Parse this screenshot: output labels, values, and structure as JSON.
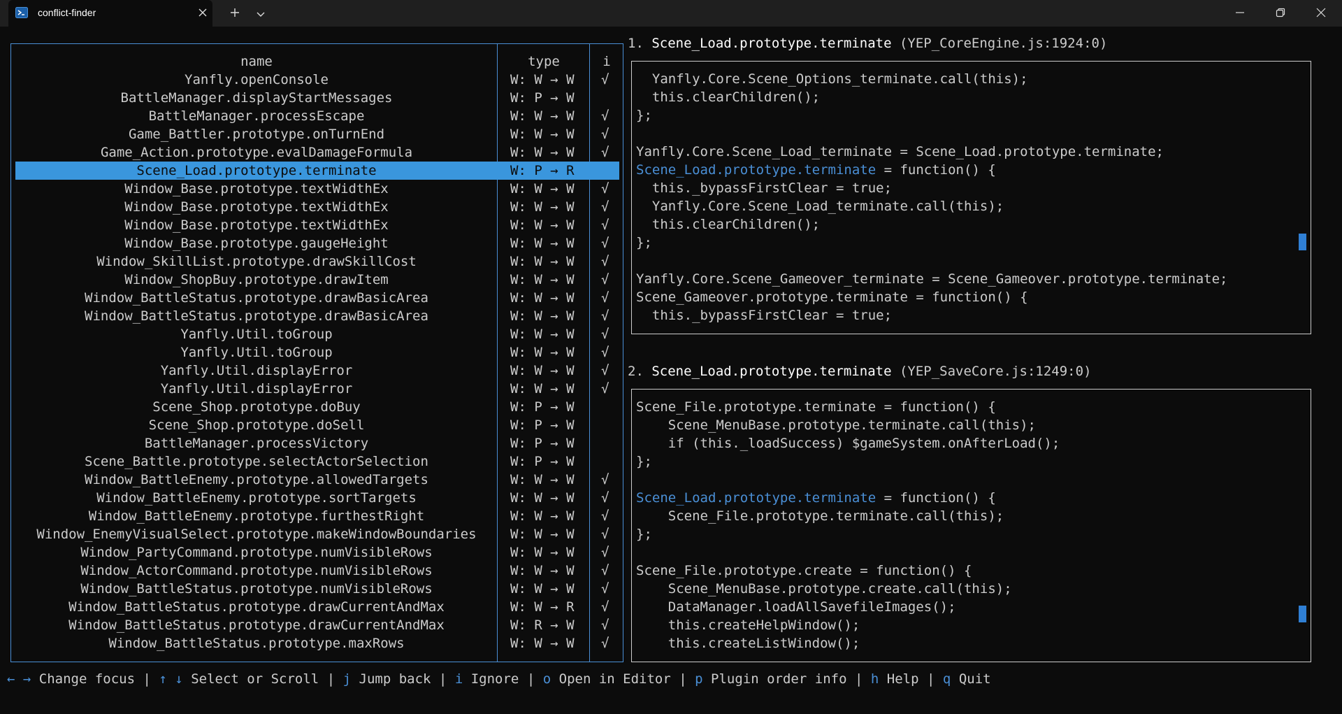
{
  "window": {
    "tab_title": "conflict-finder",
    "new_tab_icon": "plus-icon",
    "dropdown_icon": "chevron-down-icon"
  },
  "table": {
    "headers": {
      "name": "name",
      "type": "type",
      "ignore": "i"
    },
    "selected_index": 5,
    "rows": [
      {
        "name": "Yanfly.openConsole",
        "type": "W: W → W",
        "ignored": "√"
      },
      {
        "name": "BattleManager.displayStartMessages",
        "type": "W: P → W",
        "ignored": ""
      },
      {
        "name": "BattleManager.processEscape",
        "type": "W: W → W",
        "ignored": "√"
      },
      {
        "name": "Game_Battler.prototype.onTurnEnd",
        "type": "W: W → W",
        "ignored": "√"
      },
      {
        "name": "Game_Action.prototype.evalDamageFormula",
        "type": "W: W → W",
        "ignored": "√"
      },
      {
        "name": "Scene_Load.prototype.terminate",
        "type": "W: P → R",
        "ignored": ""
      },
      {
        "name": "Window_Base.prototype.textWidthEx",
        "type": "W: W → W",
        "ignored": "√"
      },
      {
        "name": "Window_Base.prototype.textWidthEx",
        "type": "W: W → W",
        "ignored": "√"
      },
      {
        "name": "Window_Base.prototype.textWidthEx",
        "type": "W: W → W",
        "ignored": "√"
      },
      {
        "name": "Window_Base.prototype.gaugeHeight",
        "type": "W: W → W",
        "ignored": "√"
      },
      {
        "name": "Window_SkillList.prototype.drawSkillCost",
        "type": "W: W → W",
        "ignored": "√"
      },
      {
        "name": "Window_ShopBuy.prototype.drawItem",
        "type": "W: W → W",
        "ignored": "√"
      },
      {
        "name": "Window_BattleStatus.prototype.drawBasicArea",
        "type": "W: W → W",
        "ignored": "√"
      },
      {
        "name": "Window_BattleStatus.prototype.drawBasicArea",
        "type": "W: W → W",
        "ignored": "√"
      },
      {
        "name": "Yanfly.Util.toGroup",
        "type": "W: W → W",
        "ignored": "√"
      },
      {
        "name": "Yanfly.Util.toGroup",
        "type": "W: W → W",
        "ignored": "√"
      },
      {
        "name": "Yanfly.Util.displayError",
        "type": "W: W → W",
        "ignored": "√"
      },
      {
        "name": "Yanfly.Util.displayError",
        "type": "W: W → W",
        "ignored": "√"
      },
      {
        "name": "Scene_Shop.prototype.doBuy",
        "type": "W: P → W",
        "ignored": ""
      },
      {
        "name": "Scene_Shop.prototype.doSell",
        "type": "W: P → W",
        "ignored": ""
      },
      {
        "name": "BattleManager.processVictory",
        "type": "W: P → W",
        "ignored": ""
      },
      {
        "name": "Scene_Battle.prototype.selectActorSelection",
        "type": "W: P → W",
        "ignored": ""
      },
      {
        "name": "Window_BattleEnemy.prototype.allowedTargets",
        "type": "W: W → W",
        "ignored": "√"
      },
      {
        "name": "Window_BattleEnemy.prototype.sortTargets",
        "type": "W: W → W",
        "ignored": "√"
      },
      {
        "name": "Window_BattleEnemy.prototype.furthestRight",
        "type": "W: W → W",
        "ignored": "√"
      },
      {
        "name": "Window_EnemyVisualSelect.prototype.makeWindowBoundaries",
        "type": "W: W → W",
        "ignored": "√"
      },
      {
        "name": "Window_PartyCommand.prototype.numVisibleRows",
        "type": "W: W → W",
        "ignored": "√"
      },
      {
        "name": "Window_ActorCommand.prototype.numVisibleRows",
        "type": "W: W → W",
        "ignored": "√"
      },
      {
        "name": "Window_BattleStatus.prototype.numVisibleRows",
        "type": "W: W → W",
        "ignored": "√"
      },
      {
        "name": "Window_BattleStatus.prototype.drawCurrentAndMax",
        "type": "W: W → R",
        "ignored": "√"
      },
      {
        "name": "Window_BattleStatus.prototype.drawCurrentAndMax",
        "type": "W: R → W",
        "ignored": "√"
      },
      {
        "name": "Window_BattleStatus.prototype.maxRows",
        "type": "W: W → W",
        "ignored": "√"
      }
    ]
  },
  "defs": [
    {
      "index": "1.",
      "func": "Scene_Load.prototype.terminate",
      "location": "(YEP_CoreEngine.js:1924:0)",
      "code": [
        {
          "text": "  Yanfly.Core.Scene_Options_terminate.call(this);"
        },
        {
          "text": "  this.clearChildren();"
        },
        {
          "text": "};"
        },
        {
          "text": ""
        },
        {
          "text": "Yanfly.Core.Scene_Load_terminate = Scene_Load.prototype.terminate;"
        },
        {
          "hl": "Scene_Load.prototype.terminate",
          "text": " = function() {"
        },
        {
          "text": "  this._bypassFirstClear = true;"
        },
        {
          "text": "  Yanfly.Core.Scene_Load_terminate.call(this);"
        },
        {
          "text": "  this.clearChildren();"
        },
        {
          "text": "};"
        },
        {
          "text": ""
        },
        {
          "text": "Yanfly.Core.Scene_Gameover_terminate = Scene_Gameover.prototype.terminate;"
        },
        {
          "text": "Scene_Gameover.prototype.terminate = function() {"
        },
        {
          "text": "  this._bypassFirstClear = true;"
        }
      ],
      "scroll_fraction": 0.68
    },
    {
      "index": "2.",
      "func": "Scene_Load.prototype.terminate",
      "location": "(YEP_SaveCore.js:1249:0)",
      "code": [
        {
          "text": "Scene_File.prototype.terminate = function() {"
        },
        {
          "text": "    Scene_MenuBase.prototype.terminate.call(this);"
        },
        {
          "text": "    if (this._loadSuccess) $gameSystem.onAfterLoad();"
        },
        {
          "text": "};"
        },
        {
          "text": ""
        },
        {
          "hl": "Scene_Load.prototype.terminate",
          "text": " = function() {"
        },
        {
          "text": "    Scene_File.prototype.terminate.call(this);"
        },
        {
          "text": "};"
        },
        {
          "text": ""
        },
        {
          "text": "Scene_File.prototype.create = function() {"
        },
        {
          "text": "    Scene_MenuBase.prototype.create.call(this);"
        },
        {
          "text": "    DataManager.loadAllSavefileImages();"
        },
        {
          "text": "    this.createHelpWindow();"
        },
        {
          "text": "    this.createListWindow();"
        }
      ],
      "scroll_fraction": 0.86
    }
  ],
  "status_bar": [
    {
      "keys": "← →",
      "label": "Change focus"
    },
    {
      "keys": "↑ ↓",
      "label": "Select or Scroll"
    },
    {
      "keys": "j",
      "label": "Jump back"
    },
    {
      "keys": "i",
      "label": "Ignore"
    },
    {
      "keys": "o",
      "label": "Open in Editor"
    },
    {
      "keys": "p",
      "label": "Plugin order info"
    },
    {
      "keys": "h",
      "label": "Help"
    },
    {
      "keys": "q",
      "label": "Quit"
    }
  ],
  "status_separator": "|"
}
